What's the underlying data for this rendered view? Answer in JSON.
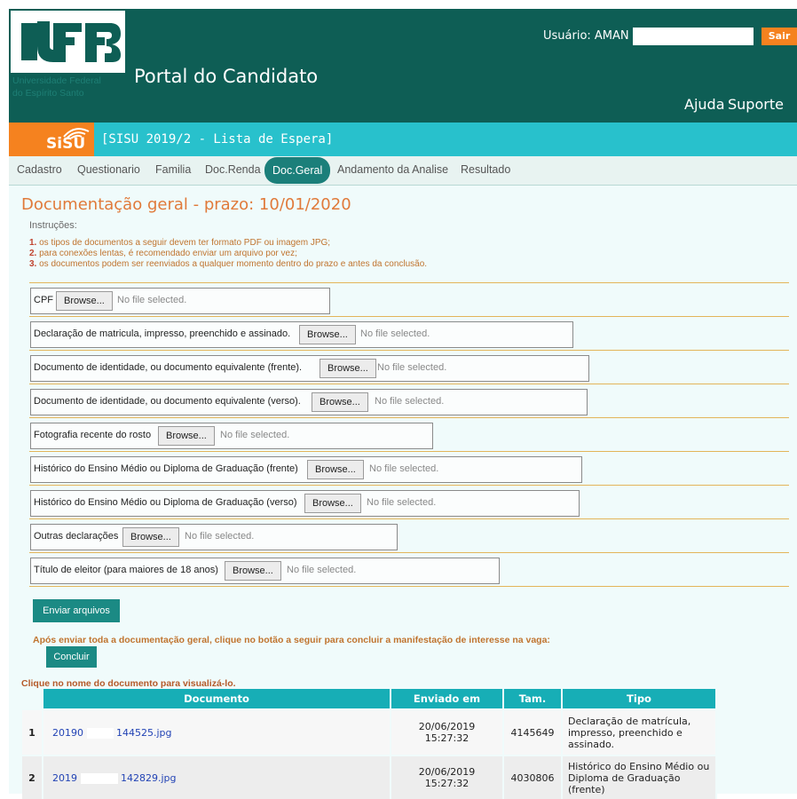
{
  "header": {
    "portal_title": "Portal do Candidato",
    "university_name_line1": "Universidade Federal",
    "university_name_line2": "do Espírito Santo",
    "logo_text": "UFES",
    "user_label": "Usuário: AMAN",
    "logout_label": "Sair",
    "help_label": "Ajuda",
    "support_label": "Suporte"
  },
  "process": {
    "logo_text": "SiSU",
    "title": "[SISU 2019/2 - Lista de Espera]"
  },
  "tabs": [
    {
      "label": "Cadastro",
      "active": false
    },
    {
      "label": "Questionario",
      "active": false
    },
    {
      "label": "Familia",
      "active": false
    },
    {
      "label": "Doc.Renda",
      "active": false
    },
    {
      "label": "Doc.Geral",
      "active": true
    },
    {
      "label": "Andamento da Analise",
      "active": false
    },
    {
      "label": "Resultado",
      "active": false
    }
  ],
  "page": {
    "title": "Documentação geral - prazo: 10/01/2020",
    "instructions_heading": "Instruções:",
    "instructions": [
      {
        "num": "1.",
        "text": " os tipos de documentos a seguir devem ter formato PDF ou imagem JPG;"
      },
      {
        "num": "2.",
        "text": " para conexões lentas, é recomendado enviar um arquivo por vez;"
      },
      {
        "num": "3.",
        "text": " os documentos podem ser reenviados a qualquer momento dentro do prazo e antes da conclusão."
      }
    ]
  },
  "upload_fields": [
    {
      "label": "CPF",
      "browse": "Browse...",
      "status": "No file selected."
    },
    {
      "label": "Declaração de matricula, impresso, preenchido e assinado.",
      "browse": "Browse...",
      "status": "No file selected."
    },
    {
      "label": "Documento de identidade, ou documento equivalente (frente).",
      "browse": "Browse...",
      "status": "No file selected."
    },
    {
      "label": "Documento de identidade, ou documento equivalente (verso).",
      "browse": "Browse...",
      "status": "No file selected."
    },
    {
      "label": "Fotografia recente do rosto",
      "browse": "Browse...",
      "status": "No file selected."
    },
    {
      "label": "Histórico do Ensino Médio ou Diploma de Graduação (frente)",
      "browse": "Browse...",
      "status": "No file selected."
    },
    {
      "label": "Histórico do Ensino Médio ou Diploma de Graduação (verso)",
      "browse": "Browse...",
      "status": "No file selected."
    },
    {
      "label": "Outras declarações",
      "browse": "Browse...",
      "status": "No file selected."
    },
    {
      "label": "Título de eleitor (para maiores de 18 anos)",
      "browse": "Browse...",
      "status": "No file selected."
    }
  ],
  "actions": {
    "send_label": "Enviar arquivos",
    "notice": "Após enviar toda a documentação geral, clique no botão a seguir para concluir a manifestação de interesse na vaga:",
    "conclude_label": "Concluir"
  },
  "documents": {
    "hint": "Clique no nome do documento para visualizá-lo.",
    "columns": [
      "Documento",
      "Enviado em",
      "Tam.",
      "Tipo"
    ],
    "rows": [
      {
        "index": "1",
        "name_start": "20190",
        "name_end": "144525.jpg",
        "sent_date": "20/06/2019",
        "sent_time": "15:27:32",
        "size": "4145649",
        "type": "Declaração de matrícula, impresso, preenchido e assinado."
      },
      {
        "index": "2",
        "name_start": "2019",
        "name_end": "142829.jpg",
        "sent_date": "20/06/2019",
        "sent_time": "15:27:32",
        "size": "4030806",
        "type": "Histórico do Ensino Médio ou Diploma de Graduação (frente)"
      }
    ]
  },
  "colors": {
    "header_bg": "#0e5e55",
    "process_bar": "#28c1cc",
    "accent_orange": "#f5821f",
    "tab_active": "#1b7f7a",
    "table_header": "#17aeb6",
    "title_orange": "#e07a3a"
  },
  "icons": [
    "ufes-logo",
    "sisu-logo-icon"
  ]
}
